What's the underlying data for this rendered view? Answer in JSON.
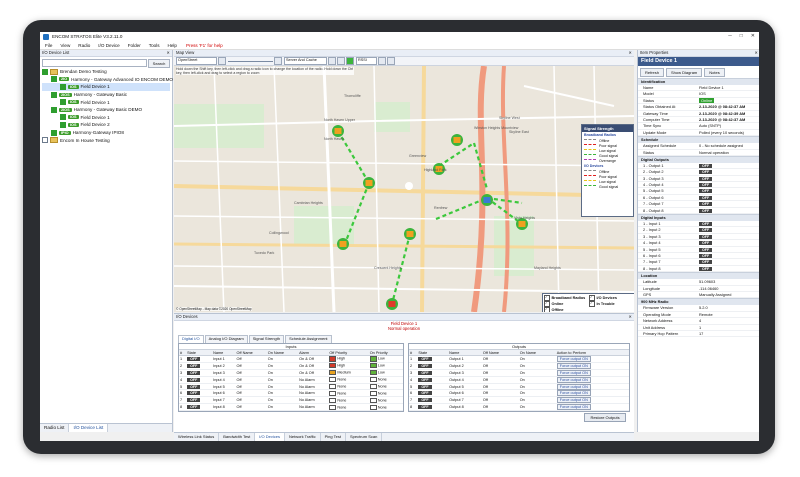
{
  "window": {
    "title": "ENCOM STRATOS Elite V3.2.11.0"
  },
  "menu": [
    "File",
    "View",
    "Radio",
    "I/O Device",
    "Folder",
    "Tools",
    "Help"
  ],
  "menu_help_hint": "Press 'F1' for help",
  "left": {
    "title": "I/O Device List",
    "search_button": "Search",
    "tree": [
      {
        "label": "Brendan Demo Testing",
        "level": 0,
        "tag": "",
        "kind": "folder",
        "checked": true,
        "selected": false
      },
      {
        "label": "Harmony - Gateway Advanced IO ENCOM DEMO",
        "level": 1,
        "tag": "2IO",
        "kind": "device",
        "checked": true,
        "selected": false
      },
      {
        "label": "Field Device 1",
        "level": 2,
        "tag": "IOS",
        "kind": "device",
        "checked": true,
        "selected": true
      },
      {
        "label": "Harmony - Gateway Basic",
        "level": 1,
        "tag": "2IOS",
        "kind": "device",
        "checked": true,
        "selected": false
      },
      {
        "label": "Field Device 1",
        "level": 2,
        "tag": "IOS",
        "kind": "device",
        "checked": true,
        "selected": false
      },
      {
        "label": "Harmony - Gateway Basic DEMO",
        "level": 1,
        "tag": "2IOS",
        "kind": "device",
        "checked": true,
        "selected": false
      },
      {
        "label": "Field Device 1",
        "level": 2,
        "tag": "IOS",
        "kind": "device",
        "checked": true,
        "selected": false
      },
      {
        "label": "Field Device 2",
        "level": 2,
        "tag": "IOS",
        "kind": "device",
        "checked": true,
        "selected": false
      },
      {
        "label": "Harmony-Gateway IPIO8",
        "level": 1,
        "tag": "IPIO",
        "kind": "device",
        "checked": true,
        "selected": false
      },
      {
        "label": "Encom In House Testing",
        "level": 0,
        "tag": "",
        "kind": "folder",
        "checked": false,
        "selected": false
      }
    ],
    "tabs": [
      "Radio List",
      "I/O Device List"
    ]
  },
  "map": {
    "title": "Map View",
    "provider": "OpenStreet",
    "cache": "Server And Cache",
    "rssi": "RSSI",
    "hint": "Hold down the Shift key, then left-click and drag a radio icon to change the location of the radio. Hold down the Ctrl key, then left-click and drag to select a region to zoom",
    "attribution": "© OpenStreetMap - Map data ©2020 OpenStreetMap",
    "places": [
      "Thorncliffe",
      "North Haven Upper",
      "North Haven",
      "Greenview",
      "Highland Park",
      "Cambrian Heights",
      "Collingwood",
      "Tuxedo Park",
      "Winston Heights Mountview",
      "Renfrew",
      "Vista Heights",
      "Skyline East",
      "Skyline West",
      "Mayland Heights",
      "Crescent Heights"
    ],
    "legend": {
      "title": "Signal Strength",
      "broadband_title": "Broadband Radios",
      "io_title": "I/O Devices",
      "items": [
        {
          "label": "Offline",
          "color": "#8a8a8a"
        },
        {
          "label": "Poor signal",
          "color": "#e02020"
        },
        {
          "label": "Low signal",
          "color": "#e8c41a"
        },
        {
          "label": "Good signal",
          "color": "#3cb43c"
        },
        {
          "label": "Overrange",
          "color": "#b43ab4"
        }
      ],
      "io_items": [
        {
          "label": "Offline",
          "color": "#8a8a8a"
        },
        {
          "label": "Poor signal",
          "color": "#e02020"
        },
        {
          "label": "Low signal",
          "color": "#e8c41a"
        },
        {
          "label": "Good signal",
          "color": "#3cb43c"
        }
      ]
    },
    "filters": [
      "Broadband Radios",
      "I/O Devices",
      "Online",
      "In Trouble",
      "Offline"
    ]
  },
  "right": {
    "title": "Item Properties",
    "header": "Field Device 1",
    "tabs": [
      "Refresh",
      "Show Diagram",
      "Notes"
    ],
    "sections": [
      {
        "name": "Identification",
        "rows": [
          [
            "Name",
            "Field Device 1"
          ],
          [
            "Model",
            "IOS"
          ],
          [
            "Status",
            "Online"
          ],
          [
            "Status Obtained At",
            "2-13-2020 @ 08:42:37 AM"
          ],
          [
            "Gateway Time",
            "2-13-2020 @ 08:42:39 AM"
          ],
          [
            "Computer Time",
            "2-13-2020 @ 08:42:37 AM"
          ],
          [
            "Time Sync",
            "Auto (SNTP)"
          ],
          [
            "Update Mode",
            "Polled (every 10 seconds)"
          ]
        ]
      },
      {
        "name": "Schedule",
        "rows": [
          [
            "Assigned Schedule",
            "0 - No schedule assigned"
          ],
          [
            "Status",
            "Normal operation"
          ]
        ]
      },
      {
        "name": "Digital Outputs",
        "rows": [
          [
            "1 - Output 1",
            "OFF"
          ],
          [
            "2 - Output 2",
            "OFF"
          ],
          [
            "3 - Output 3",
            "OFF"
          ],
          [
            "4 - Output 4",
            "OFF"
          ],
          [
            "5 - Output 5",
            "OFF"
          ],
          [
            "6 - Output 6",
            "OFF"
          ],
          [
            "7 - Output 7",
            "OFF"
          ],
          [
            "8 - Output 8",
            "OFF"
          ]
        ]
      },
      {
        "name": "Digital Inputs",
        "rows": [
          [
            "1 - Input 1",
            "OFF"
          ],
          [
            "2 - Input 2",
            "OFF"
          ],
          [
            "3 - Input 3",
            "OFF"
          ],
          [
            "4 - Input 4",
            "OFF"
          ],
          [
            "5 - Input 5",
            "OFF"
          ],
          [
            "6 - Input 6",
            "OFF"
          ],
          [
            "7 - Input 7",
            "OFF"
          ],
          [
            "8 - Input 8",
            "OFF"
          ]
        ]
      },
      {
        "name": "Location",
        "rows": [
          [
            "Latitude",
            "51.09603"
          ],
          [
            "Longitude",
            "-114.06460"
          ],
          [
            "GPS",
            "Manually Assigned"
          ]
        ]
      },
      {
        "name": "900 MHz Radio",
        "rows": [
          [
            "Firmware Version",
            "5.2.0"
          ],
          [
            "Operating Mode",
            "Remote"
          ],
          [
            "Network Address",
            "4"
          ],
          [
            "Unit Address",
            "1"
          ],
          [
            "Primary Hop Pattern",
            "17"
          ]
        ]
      }
    ]
  },
  "io": {
    "title": "I/O Devices",
    "device": "Field Device 1",
    "status": "Normal operation",
    "tabs": [
      "Digital I/O",
      "Analog I/O Diagram",
      "Signal Strength",
      "Schedule Assignment"
    ],
    "inputs_title": "Inputs",
    "outputs_title": "Outputs",
    "input_cols": [
      "#",
      "State",
      "Name",
      "Off Name",
      "On Name",
      "Alarm",
      "Off Priority",
      "On Priority"
    ],
    "output_cols": [
      "#",
      "State",
      "Name",
      "Off Name",
      "On Name",
      "Action to Perform"
    ],
    "inputs": [
      [
        "1",
        "OFF",
        "Input 1",
        "Off",
        "On",
        "On & Off",
        "High",
        "Low"
      ],
      [
        "2",
        "OFF",
        "Input 2",
        "Off",
        "On",
        "On & Off",
        "High",
        "Low"
      ],
      [
        "3",
        "OFF",
        "Input 3",
        "Off",
        "On",
        "On & Off",
        "Medium",
        "Low"
      ],
      [
        "4",
        "OFF",
        "Input 4",
        "Off",
        "On",
        "No Alarm",
        "None",
        "None"
      ],
      [
        "5",
        "OFF",
        "Input 5",
        "Off",
        "On",
        "No Alarm",
        "None",
        "None"
      ],
      [
        "6",
        "OFF",
        "Input 6",
        "Off",
        "On",
        "No Alarm",
        "None",
        "None"
      ],
      [
        "7",
        "OFF",
        "Input 7",
        "Off",
        "On",
        "No Alarm",
        "None",
        "None"
      ],
      [
        "8",
        "OFF",
        "Input 8",
        "Off",
        "On",
        "No Alarm",
        "None",
        "None"
      ]
    ],
    "outputs": [
      [
        "1",
        "OFF",
        "Output 1",
        "Off",
        "On",
        "Force output ON"
      ],
      [
        "2",
        "OFF",
        "Output 2",
        "Off",
        "On",
        "Force output ON"
      ],
      [
        "3",
        "OFF",
        "Output 3",
        "Off",
        "On",
        "Force output ON"
      ],
      [
        "4",
        "OFF",
        "Output 4",
        "Off",
        "On",
        "Force output ON"
      ],
      [
        "5",
        "OFF",
        "Output 5",
        "Off",
        "On",
        "Force output ON"
      ],
      [
        "6",
        "OFF",
        "Output 6",
        "Off",
        "On",
        "Force output ON"
      ],
      [
        "7",
        "OFF",
        "Output 7",
        "Off",
        "On",
        "Force output ON"
      ],
      [
        "8",
        "OFF",
        "Output 8",
        "Off",
        "On",
        "Force output ON"
      ]
    ],
    "restore_button": "Restore Outputs",
    "bottom_tabs": [
      "Wireless Link Status",
      "Bandwidth Test",
      "I/O Devices",
      "Network Traffic",
      "Ping Test",
      "Spectrum Scan"
    ]
  },
  "colors": {
    "accent": "#3c5a8c",
    "online": "#2fa02f",
    "link": "#3cc83c",
    "alert": "#c00000"
  }
}
